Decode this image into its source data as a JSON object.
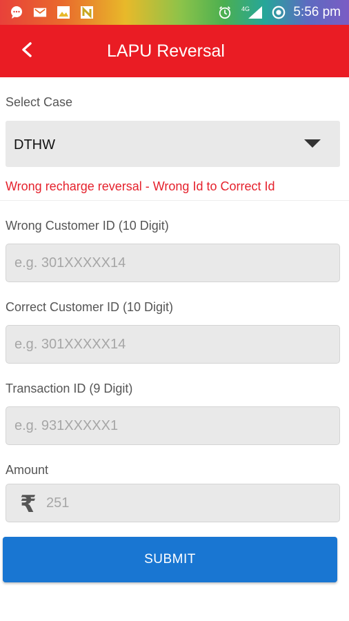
{
  "status_bar": {
    "time": "5:56 pm",
    "network": "4G",
    "icons": [
      "chat-bubble-icon",
      "gmail-icon",
      "image-icon",
      "n-app-icon",
      "alarm-icon",
      "signal-icon",
      "data-saver-icon"
    ]
  },
  "app_bar": {
    "title": "LAPU Reversal",
    "back_icon": "arrow-back-icon",
    "color": "#ea1c24"
  },
  "form": {
    "select_case_label": "Select Case",
    "select_case_value": "DTHW",
    "case_description": "Wrong recharge reversal - Wrong Id to Correct Id",
    "wrong_customer_label": "Wrong Customer ID (10 Digit)",
    "wrong_customer_placeholder": "e.g. 301XXXXX14",
    "correct_customer_label": "Correct Customer ID (10 Digit)",
    "correct_customer_placeholder": "e.g. 301XXXXX14",
    "transaction_label": "Transaction ID (9 Digit)",
    "transaction_placeholder": "e.g. 931XXXXX1",
    "amount_label": "Amount",
    "amount_currency_symbol": "₹",
    "amount_placeholder": "251",
    "submit_label": "SUBMIT"
  },
  "colors": {
    "accent_red": "#ea1c24",
    "error_text": "#e5212c",
    "submit_blue": "#1976d2"
  }
}
